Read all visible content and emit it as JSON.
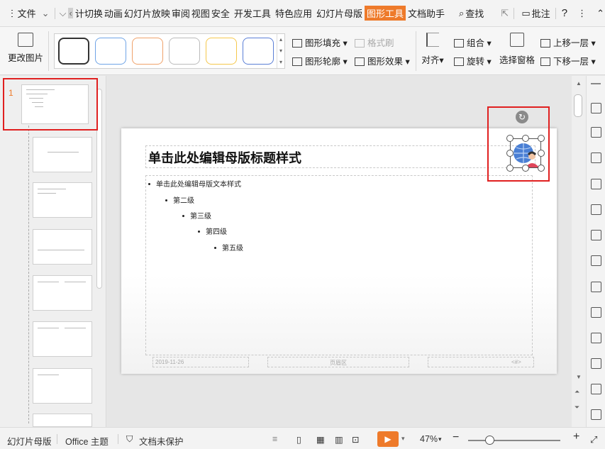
{
  "menubar": {
    "file": "文件",
    "tabs": [
      "计切换",
      "动画",
      "幻灯片放映",
      "审阅",
      "视图",
      "安全",
      "开发工具",
      "特色应用",
      "幻灯片母版",
      "图形工具",
      "文档助手"
    ],
    "active_tab": "图形工具",
    "search": "查找",
    "comment": "批注",
    "help": "?"
  },
  "ribbon": {
    "change_picture": "更改图片",
    "shape_fill": "图形填充",
    "format_painter": "格式刷",
    "shape_outline": "图形轮廓",
    "shape_effect": "图形效果",
    "align": "对齐",
    "group": "组合",
    "rotate": "旋转",
    "selection_pane": "选择窗格",
    "bring_forward": "上移一层",
    "send_backward": "下移一层",
    "style_colors": [
      "#333333",
      "#6fa4e6",
      "#f0a26a",
      "#bbbbbb",
      "#f5c84c",
      "#5b7fd6"
    ]
  },
  "thumbnails": {
    "slide_number": "1"
  },
  "slide": {
    "title": "单击此处编辑母版标题样式",
    "levels": [
      "单击此处编辑母版文本样式",
      "第二级",
      "第三级",
      "第四级",
      "第五级"
    ],
    "footer_date": "2019-11-26",
    "footer_center": "页眉区",
    "footer_num": "<#>"
  },
  "statusbar": {
    "view_name": "幻灯片母版",
    "theme": "Office 主题",
    "protect": "文档未保护",
    "zoom": "47%"
  },
  "colors": {
    "accent": "#ee7a2a",
    "highlight": "#e02020"
  }
}
